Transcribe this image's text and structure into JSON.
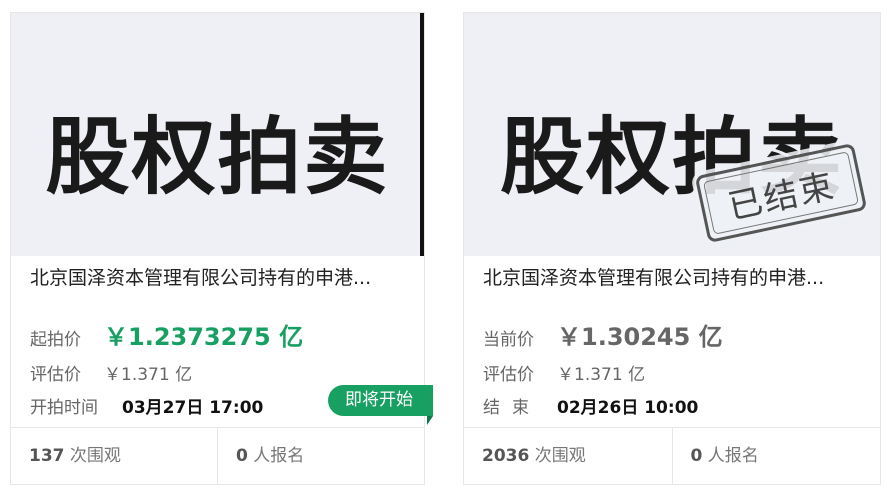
{
  "cards": [
    {
      "image_text": "股权拍卖",
      "title": "北京国泽资本管理有限公司持有的申港...",
      "price_label": "起拍价",
      "price_value": "￥1.2373275 亿",
      "price_color": "#18a062",
      "eval_label": "评估价",
      "eval_value": "￥1.371 亿",
      "time_label": "开拍时间",
      "time_value": "03月27日 17:00",
      "badge": "即将开始",
      "views_count": "137",
      "views_label": "次围观",
      "signups_count": "0",
      "signups_label": "人报名"
    },
    {
      "image_text": "股权拍卖",
      "stamp": "已结束",
      "title": "北京国泽资本管理有限公司持有的申港...",
      "price_label": "当前价",
      "price_value": "￥1.30245 亿",
      "price_color": "#666666",
      "eval_label": "评估价",
      "eval_value": "￥1.371 亿",
      "time_label": "结束",
      "time_value": "02月26日 10:00",
      "views_count": "2036",
      "views_label": "次围观",
      "signups_count": "0",
      "signups_label": "人报名"
    }
  ]
}
